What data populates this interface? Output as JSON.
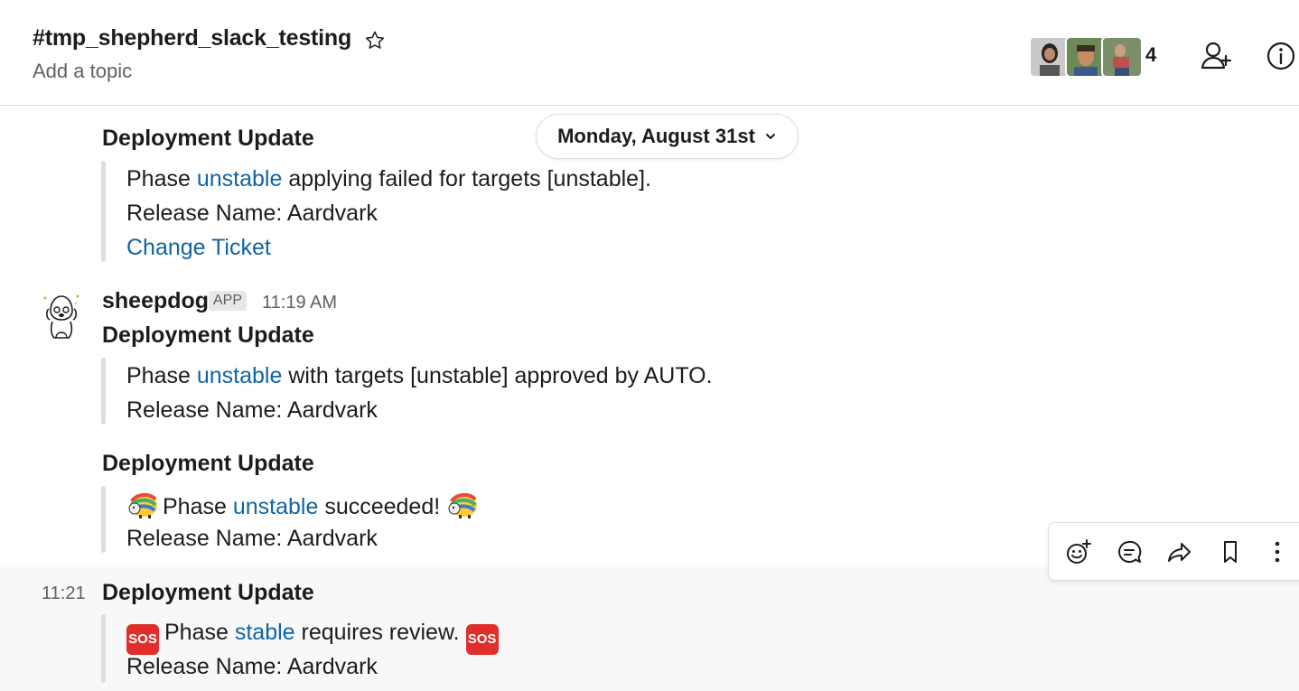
{
  "header": {
    "channel": "#tmp_shepherd_slack_testing",
    "topic": "Add a topic",
    "member_count": "4"
  },
  "date_divider": "Monday, August 31st",
  "messages": [
    {
      "title": "Deployment Update",
      "line1_pre": "Phase ",
      "line1_link": "unstable",
      "line1_post": " applying failed for targets [unstable].",
      "line2": "Release Name: Aardvark",
      "link": "Change Ticket"
    },
    {
      "sender": "sheepdog",
      "badge": "APP",
      "time": "11:19 AM",
      "title": "Deployment Update",
      "line1_pre": "Phase ",
      "line1_link": "unstable",
      "line1_post": " with targets [unstable] approved by AUTO.",
      "line2": "Release Name: Aardvark"
    },
    {
      "title": "Deployment Update",
      "line1_pre": "Phase ",
      "line1_link": "unstable",
      "line1_post": " succeeded!",
      "line2": "Release Name: Aardvark"
    },
    {
      "time": "11:21",
      "title": "Deployment Update",
      "emoji_label": "SOS",
      "line1_pre": "Phase ",
      "line1_link": "stable",
      "line1_post": " requires review.",
      "line2": "Release Name: Aardvark"
    }
  ],
  "colors": {
    "link": "#1264a3",
    "sos": "#e02e2a",
    "hover_bg": "#f8f8f8"
  },
  "icons": [
    "star-icon",
    "add-member-icon",
    "info-icon",
    "add-reaction-icon",
    "reply-thread-icon",
    "share-icon",
    "bookmark-icon",
    "more-actions-icon",
    "party-sheep-icon"
  ]
}
